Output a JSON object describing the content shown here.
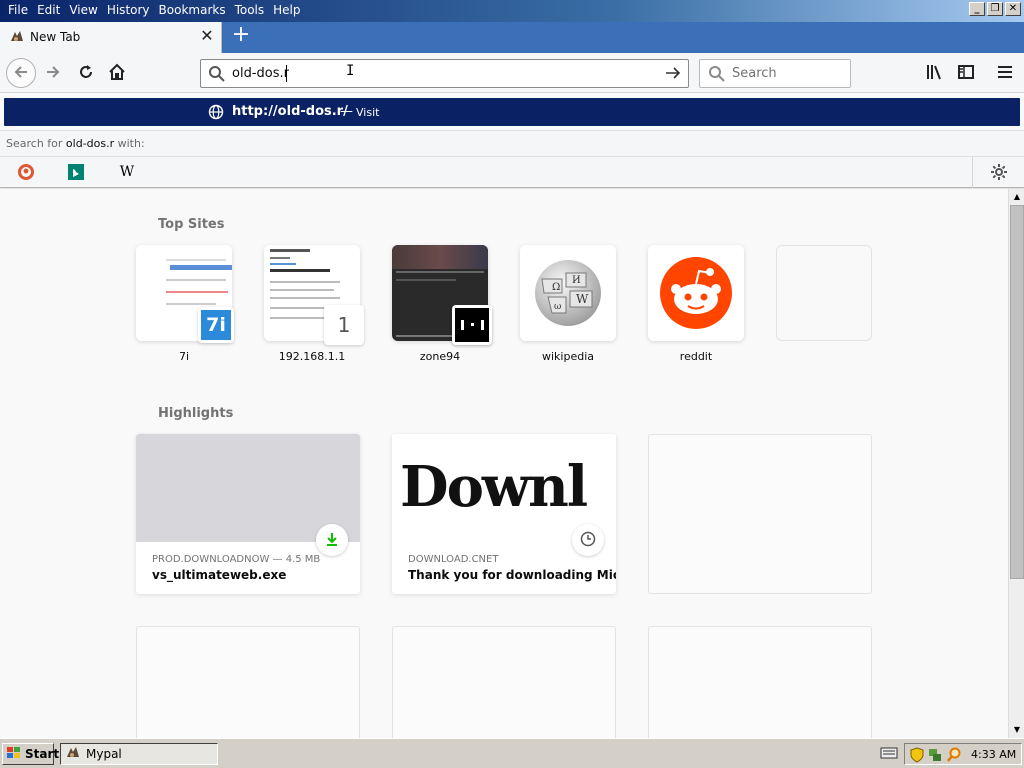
{
  "menubar": {
    "items": [
      "File",
      "Edit",
      "View",
      "History",
      "Bookmarks",
      "Tools",
      "Help"
    ],
    "controls": {
      "minimize": "_",
      "restore": "❐",
      "close": "✕"
    }
  },
  "tab": {
    "title": "New Tab",
    "close_glyph": "✕"
  },
  "newtab": {
    "glyph": "+"
  },
  "urlbar": {
    "value": "old-dos.r"
  },
  "searchbar": {
    "placeholder": "Search"
  },
  "autocomplete": {
    "visit_url": "http://old-dos.r/",
    "separator": "—",
    "action": "Visit",
    "hint_prefix": "Search for ",
    "hint_term": "old-dos.r",
    "hint_suffix": " with:",
    "engines": [
      "duckduckgo-icon",
      "bing-icon",
      "wikipedia-icon"
    ]
  },
  "top_sites": {
    "title": "Top Sites",
    "sites": [
      {
        "label": "7i",
        "badge": "7i"
      },
      {
        "label": "192.168.1.1",
        "badge": "1"
      },
      {
        "label": "zone94"
      },
      {
        "label": "wikipedia"
      },
      {
        "label": "reddit"
      },
      {
        "label": ""
      }
    ]
  },
  "highlights": {
    "title": "Highlights",
    "cards": [
      {
        "host": "PROD.DOWNLOADNOW — 4.5 MB",
        "title": "vs_ultimateweb.exe",
        "badge": "download-icon"
      },
      {
        "host": "DOWNLOAD.CNET",
        "title": "Thank you for downloading Micr...",
        "image_text": "Downl",
        "badge": "clock-icon"
      }
    ]
  },
  "taskbar": {
    "start_label": "Start",
    "window_label": "Mypal",
    "clock": "4:33 AM"
  },
  "colors": {
    "autocomplete_bg": "#0a2264",
    "reddit": "#ff4500",
    "download_green": "#12bc00"
  }
}
